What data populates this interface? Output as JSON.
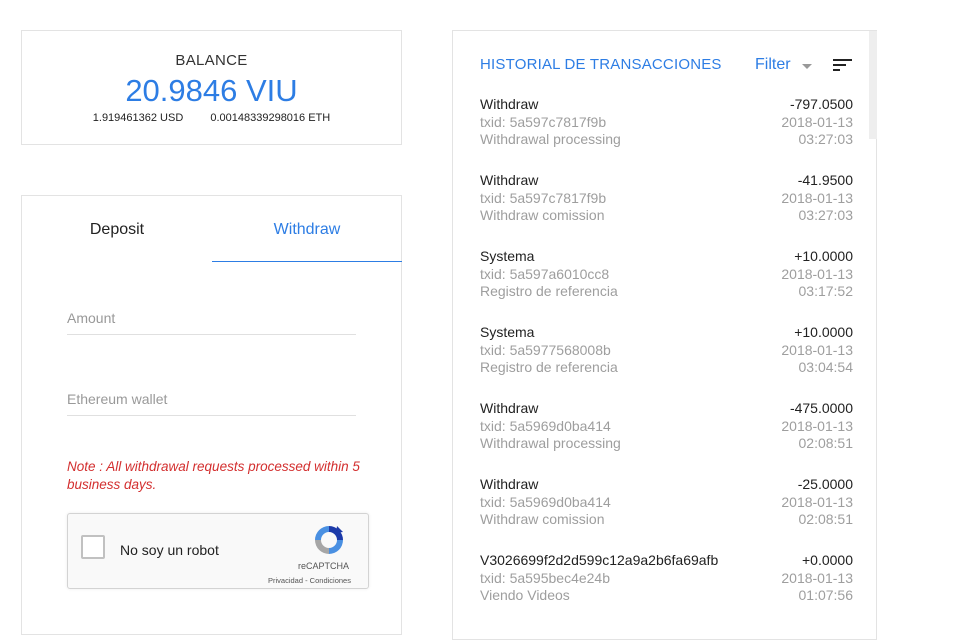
{
  "balance": {
    "label": "BALANCE",
    "value": "20.9846 VIU",
    "usd": "1.919461362 USD",
    "eth": "0.00148339298016 ETH"
  },
  "tabs": {
    "deposit": "Deposit",
    "withdraw": "Withdraw"
  },
  "form": {
    "amount_placeholder": "Amount",
    "wallet_placeholder": "Ethereum wallet",
    "note": "Note : All withdrawal requests processed within 5 business days."
  },
  "captcha": {
    "label": "No soy un robot",
    "brand": "reCAPTCHA",
    "links": "Privacidad - Condiciones"
  },
  "history": {
    "title": "HISTORIAL DE TRANSACCIONES",
    "filter_label": "Filter",
    "icons": {
      "filter_caret": "caret-down-icon",
      "sort": "sort-icon"
    },
    "transactions": [
      {
        "type": "Withdraw",
        "amount": "-797.0500",
        "txid": "txid: 5a597c7817f9b",
        "date": "2018-01-13",
        "description": "Withdrawal processing",
        "time": "03:27:03"
      },
      {
        "type": "Withdraw",
        "amount": "-41.9500",
        "txid": "txid: 5a597c7817f9b",
        "date": "2018-01-13",
        "description": "Withdraw comission",
        "time": "03:27:03"
      },
      {
        "type": "Systema",
        "amount": "+10.0000",
        "txid": "txid: 5a597a6010cc8",
        "date": "2018-01-13",
        "description": "Registro de referencia",
        "time": "03:17:52"
      },
      {
        "type": "Systema",
        "amount": "+10.0000",
        "txid": "txid: 5a5977568008b",
        "date": "2018-01-13",
        "description": "Registro de referencia",
        "time": "03:04:54"
      },
      {
        "type": "Withdraw",
        "amount": "-475.0000",
        "txid": "txid: 5a5969d0ba414",
        "date": "2018-01-13",
        "description": "Withdrawal processing",
        "time": "02:08:51"
      },
      {
        "type": "Withdraw",
        "amount": "-25.0000",
        "txid": "txid: 5a5969d0ba414",
        "date": "2018-01-13",
        "description": "Withdraw comission",
        "time": "02:08:51"
      },
      {
        "type": "V3026699f2d2d599c12a9a2b6fa69afb",
        "amount": "+0.0000",
        "txid": "txid: 5a595bec4e24b",
        "date": "2018-01-13",
        "description": "Viendo Videos",
        "time": "01:07:56"
      }
    ]
  },
  "colors": {
    "accent": "#2d7de4",
    "note": "#d32f2f",
    "muted": "#9e9e9e"
  }
}
